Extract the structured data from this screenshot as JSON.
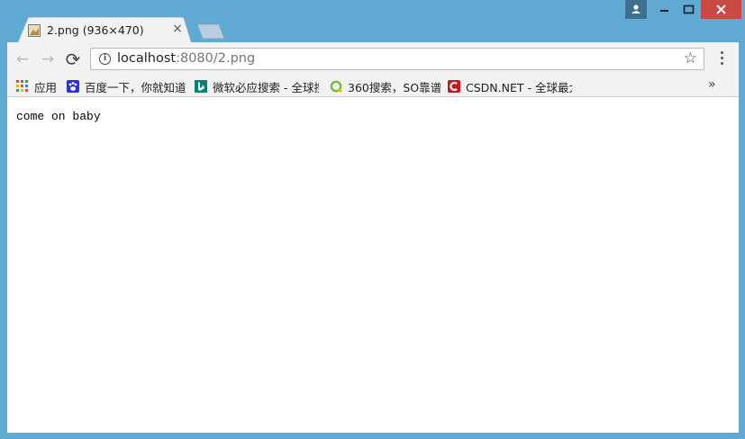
{
  "tab": {
    "title": "2.png (936×470)",
    "close_glyph": "×",
    "favicon": "image-thumbnail-icon"
  },
  "window_controls": {
    "profile": "person-icon",
    "minimize": "minimize-icon",
    "maximize": "maximize-icon",
    "close": "close-icon"
  },
  "toolbar": {
    "back": "←",
    "forward": "→",
    "reload": "⟳",
    "url_host": "localhost",
    "url_rest": ":8080/2.png",
    "star": "☆"
  },
  "bookmarks": {
    "items": [
      {
        "label": "应用",
        "icon": "apps-grid-icon"
      },
      {
        "label": "百度一下，你就知道",
        "icon": "baidu-paw-icon"
      },
      {
        "label": "微软必应搜索 - 全球搜",
        "icon": "bing-icon"
      },
      {
        "label": "360搜索，SO靠谱",
        "icon": "so360-icon"
      },
      {
        "label": "CSDN.NET - 全球最大",
        "icon": "csdn-icon"
      }
    ],
    "more": "»"
  },
  "page": {
    "text": "come on baby"
  },
  "colors": {
    "frame": "#5fa9d2",
    "toolbar": "#f2f2f2",
    "close_button": "#c94a43"
  }
}
